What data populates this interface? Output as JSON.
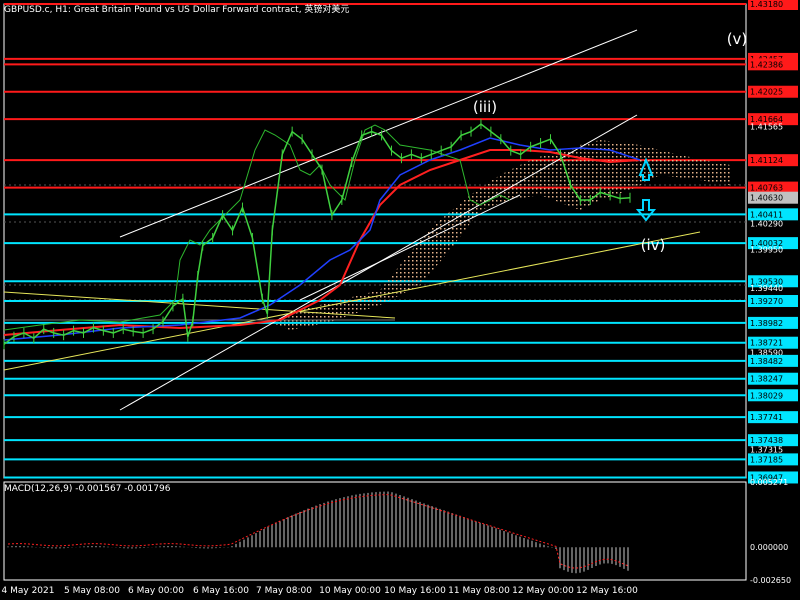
{
  "title": "GBPUSD.c, H1:  Great Britain Pound vs US Dollar Forward contract, 英镑对美元",
  "macd_label": "MACD(12,26,9) -0.001567 -0.001796",
  "colors": {
    "background": "#000000",
    "red_level": "#ff1a1a",
    "cyan_level": "#00e5ff",
    "price": "#3fd13f",
    "ma_red": "#ff2020",
    "ma_blue": "#2040ff",
    "ichimoku_cloud": "#e6b48c",
    "trend_white": "#ffffff",
    "trend_yellow": "#e6e65a",
    "arrow": "#00d5ff",
    "macd_hist": "#c8c8c8",
    "macd_signal": "#ff2020"
  },
  "chart_data": [
    {
      "type": "line",
      "title": "GBPUSD.c, H1",
      "x": [
        "4 May 2021",
        "5 May 08:00",
        "6 May 00:00",
        "6 May 16:00",
        "7 May 08:00",
        "10 May 00:00",
        "10 May 16:00",
        "11 May 08:00",
        "12 May 00:00",
        "12 May 16:00"
      ],
      "ylim": [
        1.3694,
        1.4318
      ],
      "series": [
        {
          "x": [
            0,
            10,
            20,
            30,
            40,
            50,
            60,
            70,
            80,
            90,
            100,
            110,
            120,
            130,
            140,
            150,
            160,
            170,
            180,
            185,
            190,
            195,
            200,
            210,
            220,
            230,
            240,
            250,
            260,
            265,
            270,
            280,
            290,
            300,
            310,
            320,
            330,
            340,
            350,
            360,
            370,
            380,
            390,
            400,
            410,
            420,
            430,
            440,
            450,
            460,
            470,
            480,
            490,
            500,
            510,
            520,
            530,
            540,
            550,
            560,
            570,
            580,
            590,
            600,
            610,
            620,
            630
          ],
          "values": [
            1.387,
            1.388,
            1.3885,
            1.3878,
            1.389,
            1.3885,
            1.3882,
            1.3888,
            1.3885,
            1.3892,
            1.3888,
            1.3885,
            1.389,
            1.3887,
            1.3885,
            1.389,
            1.39,
            1.392,
            1.393,
            1.388,
            1.39,
            1.396,
            1.4,
            1.401,
            1.404,
            1.402,
            1.405,
            1.401,
            1.393,
            1.391,
            1.402,
            1.412,
            1.415,
            1.414,
            1.412,
            1.41,
            1.404,
            1.406,
            1.411,
            1.4145,
            1.415,
            1.4145,
            1.4125,
            1.4115,
            1.412,
            1.4115,
            1.412,
            1.4125,
            1.413,
            1.4145,
            1.415,
            1.416,
            1.415,
            1.414,
            1.4125,
            1.412,
            1.413,
            1.4135,
            1.414,
            1.412,
            1.408,
            1.406,
            1.406,
            1.407,
            1.4066,
            1.4062,
            1.4063
          ]
        },
        {
          "name": "",
          "values": []
        }
      ],
      "levels_red": [
        1.4318,
        1.42457,
        1.42386,
        1.42025,
        1.41664,
        1.41124,
        1.40763
      ],
      "levels_cyan": [
        1.40411,
        1.40032,
        1.3953,
        1.3927,
        1.38982,
        1.38721,
        1.38482,
        1.38247,
        1.38029,
        1.37741,
        1.37438,
        1.37185,
        1.36947
      ],
      "right_axis_labels": [
        "1.43180",
        "1.42457",
        "1.42386",
        "1.42025",
        "1.41664",
        "1.41565",
        "1.41124",
        "1.40763",
        "1.40630",
        "1.40411",
        "1.40290",
        "1.40032",
        "1.39950",
        "1.39530",
        "1.39440",
        "1.39270",
        "1.38982",
        "1.38721",
        "1.38590",
        "1.38482",
        "1.38247",
        "1.38029",
        "1.37741",
        "1.37438",
        "1.37315",
        "1.37185",
        "1.36947"
      ],
      "current_price": "1.40630",
      "annotations": [
        "(iii)",
        "(iv)",
        "(v)"
      ]
    },
    {
      "type": "bar",
      "title": "MACD(12,26,9)",
      "ylabels": [
        "0.005271",
        "0.000000",
        "-0.002650"
      ],
      "ylim": [
        -0.00265,
        0.005271
      ],
      "values": [
        0.0,
        0.0,
        0.0,
        0.0,
        0.0,
        0.0,
        0.0,
        0.0,
        0.0,
        0.0,
        0.0,
        0.0,
        0.0,
        0.0,
        0.0,
        0.0,
        0.0,
        0.0,
        0.0,
        0.0,
        0.0,
        0.0,
        0.0,
        0.0,
        0.0,
        0.0
      ]
    }
  ]
}
